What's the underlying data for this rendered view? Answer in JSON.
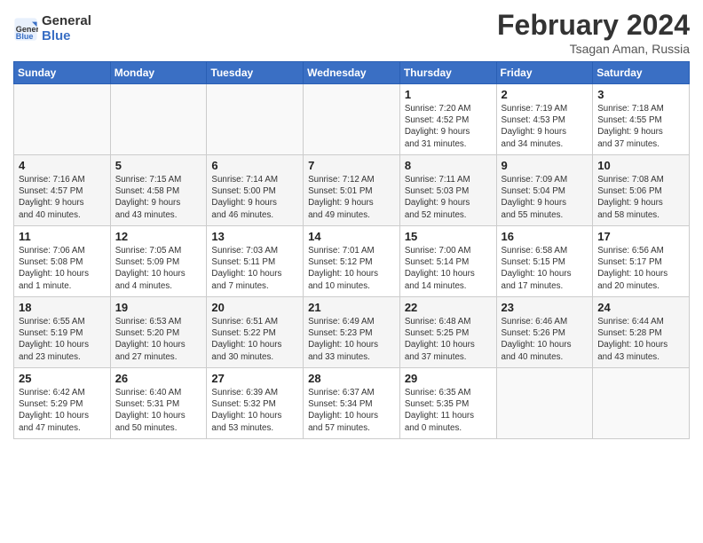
{
  "header": {
    "logo_line1": "General",
    "logo_line2": "Blue",
    "title": "February 2024",
    "subtitle": "Tsagan Aman, Russia"
  },
  "weekdays": [
    "Sunday",
    "Monday",
    "Tuesday",
    "Wednesday",
    "Thursday",
    "Friday",
    "Saturday"
  ],
  "weeks": [
    [
      {
        "day": "",
        "info": ""
      },
      {
        "day": "",
        "info": ""
      },
      {
        "day": "",
        "info": ""
      },
      {
        "day": "",
        "info": ""
      },
      {
        "day": "1",
        "info": "Sunrise: 7:20 AM\nSunset: 4:52 PM\nDaylight: 9 hours\nand 31 minutes."
      },
      {
        "day": "2",
        "info": "Sunrise: 7:19 AM\nSunset: 4:53 PM\nDaylight: 9 hours\nand 34 minutes."
      },
      {
        "day": "3",
        "info": "Sunrise: 7:18 AM\nSunset: 4:55 PM\nDaylight: 9 hours\nand 37 minutes."
      }
    ],
    [
      {
        "day": "4",
        "info": "Sunrise: 7:16 AM\nSunset: 4:57 PM\nDaylight: 9 hours\nand 40 minutes."
      },
      {
        "day": "5",
        "info": "Sunrise: 7:15 AM\nSunset: 4:58 PM\nDaylight: 9 hours\nand 43 minutes."
      },
      {
        "day": "6",
        "info": "Sunrise: 7:14 AM\nSunset: 5:00 PM\nDaylight: 9 hours\nand 46 minutes."
      },
      {
        "day": "7",
        "info": "Sunrise: 7:12 AM\nSunset: 5:01 PM\nDaylight: 9 hours\nand 49 minutes."
      },
      {
        "day": "8",
        "info": "Sunrise: 7:11 AM\nSunset: 5:03 PM\nDaylight: 9 hours\nand 52 minutes."
      },
      {
        "day": "9",
        "info": "Sunrise: 7:09 AM\nSunset: 5:04 PM\nDaylight: 9 hours\nand 55 minutes."
      },
      {
        "day": "10",
        "info": "Sunrise: 7:08 AM\nSunset: 5:06 PM\nDaylight: 9 hours\nand 58 minutes."
      }
    ],
    [
      {
        "day": "11",
        "info": "Sunrise: 7:06 AM\nSunset: 5:08 PM\nDaylight: 10 hours\nand 1 minute."
      },
      {
        "day": "12",
        "info": "Sunrise: 7:05 AM\nSunset: 5:09 PM\nDaylight: 10 hours\nand 4 minutes."
      },
      {
        "day": "13",
        "info": "Sunrise: 7:03 AM\nSunset: 5:11 PM\nDaylight: 10 hours\nand 7 minutes."
      },
      {
        "day": "14",
        "info": "Sunrise: 7:01 AM\nSunset: 5:12 PM\nDaylight: 10 hours\nand 10 minutes."
      },
      {
        "day": "15",
        "info": "Sunrise: 7:00 AM\nSunset: 5:14 PM\nDaylight: 10 hours\nand 14 minutes."
      },
      {
        "day": "16",
        "info": "Sunrise: 6:58 AM\nSunset: 5:15 PM\nDaylight: 10 hours\nand 17 minutes."
      },
      {
        "day": "17",
        "info": "Sunrise: 6:56 AM\nSunset: 5:17 PM\nDaylight: 10 hours\nand 20 minutes."
      }
    ],
    [
      {
        "day": "18",
        "info": "Sunrise: 6:55 AM\nSunset: 5:19 PM\nDaylight: 10 hours\nand 23 minutes."
      },
      {
        "day": "19",
        "info": "Sunrise: 6:53 AM\nSunset: 5:20 PM\nDaylight: 10 hours\nand 27 minutes."
      },
      {
        "day": "20",
        "info": "Sunrise: 6:51 AM\nSunset: 5:22 PM\nDaylight: 10 hours\nand 30 minutes."
      },
      {
        "day": "21",
        "info": "Sunrise: 6:49 AM\nSunset: 5:23 PM\nDaylight: 10 hours\nand 33 minutes."
      },
      {
        "day": "22",
        "info": "Sunrise: 6:48 AM\nSunset: 5:25 PM\nDaylight: 10 hours\nand 37 minutes."
      },
      {
        "day": "23",
        "info": "Sunrise: 6:46 AM\nSunset: 5:26 PM\nDaylight: 10 hours\nand 40 minutes."
      },
      {
        "day": "24",
        "info": "Sunrise: 6:44 AM\nSunset: 5:28 PM\nDaylight: 10 hours\nand 43 minutes."
      }
    ],
    [
      {
        "day": "25",
        "info": "Sunrise: 6:42 AM\nSunset: 5:29 PM\nDaylight: 10 hours\nand 47 minutes."
      },
      {
        "day": "26",
        "info": "Sunrise: 6:40 AM\nSunset: 5:31 PM\nDaylight: 10 hours\nand 50 minutes."
      },
      {
        "day": "27",
        "info": "Sunrise: 6:39 AM\nSunset: 5:32 PM\nDaylight: 10 hours\nand 53 minutes."
      },
      {
        "day": "28",
        "info": "Sunrise: 6:37 AM\nSunset: 5:34 PM\nDaylight: 10 hours\nand 57 minutes."
      },
      {
        "day": "29",
        "info": "Sunrise: 6:35 AM\nSunset: 5:35 PM\nDaylight: 11 hours\nand 0 minutes."
      },
      {
        "day": "",
        "info": ""
      },
      {
        "day": "",
        "info": ""
      }
    ]
  ]
}
